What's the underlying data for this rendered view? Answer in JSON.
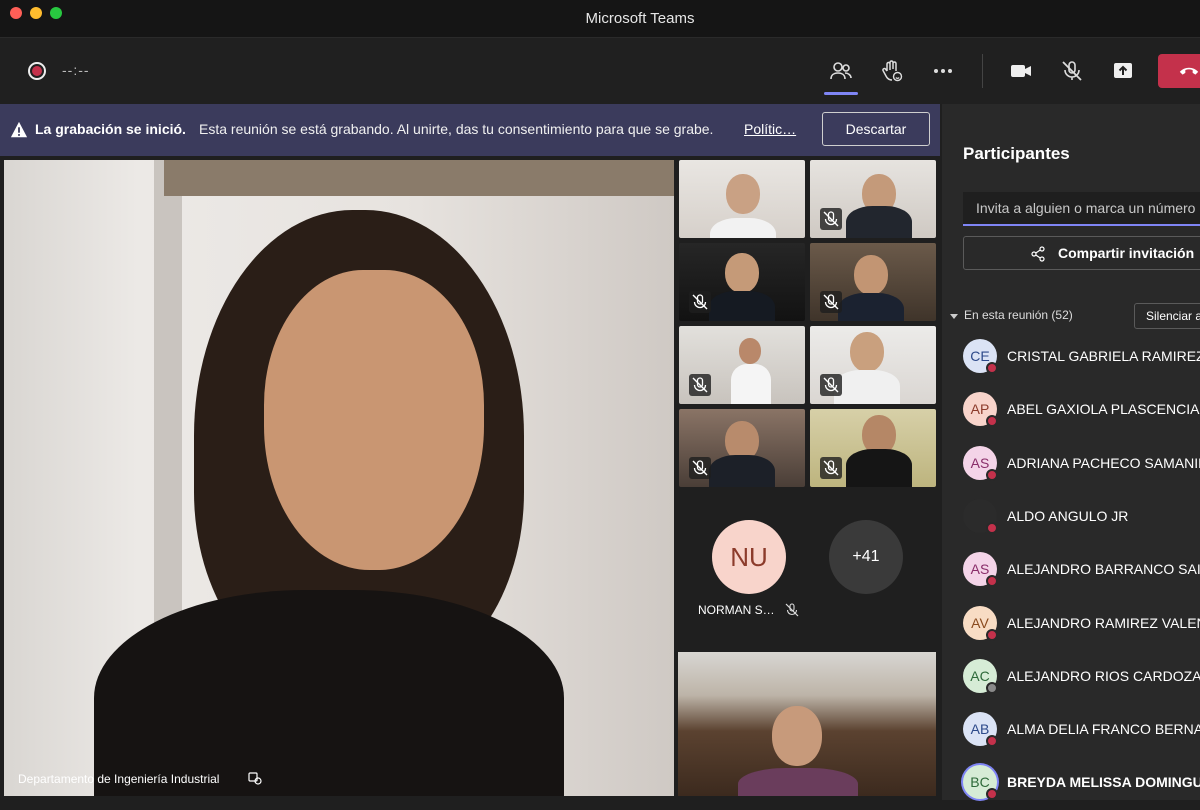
{
  "window": {
    "title": "Microsoft Teams"
  },
  "toolbar": {
    "recording_time": "--:--",
    "buttons": [
      {
        "icon": "people-icon"
      },
      {
        "icon": "raise-hand-icon"
      },
      {
        "icon": "more-options-icon"
      },
      {
        "icon": "camera-icon"
      },
      {
        "icon": "mic-off-icon"
      },
      {
        "icon": "share-screen-icon"
      },
      {
        "icon": "hang-up-icon"
      }
    ],
    "hangup_color": "#c4314b",
    "active_accent": "#7f85f5"
  },
  "banner": {
    "bold_text": "La grabación se inició.",
    "text": "Esta reunión se está grabando. Al unirte, das tu consentimiento para que se grabe.",
    "link": "Polític…",
    "dismiss_label": "Descartar"
  },
  "stage": {
    "main_name": "Departamento de Ingeniería Industrial",
    "avatar_initials": "NU",
    "avatar_name": "NORMAN S…",
    "more_count": "+41"
  },
  "panel": {
    "title": "Participantes",
    "invite_placeholder": "Invita a alguien o marca un número",
    "share_label": "Compartir invitación",
    "section_label": "En esta reunión (52)",
    "mute_all_label": "Silenciar a todos",
    "participants": [
      {
        "initials": "CE",
        "name": "CRISTAL GABRIELA RAMIREZ",
        "bg": "#dbe3f5",
        "fg": "#2e4a8a"
      },
      {
        "initials": "AP",
        "name": "ABEL GAXIOLA PLASCENCIA",
        "bg": "#f8d4cb",
        "fg": "#8c3b2b"
      },
      {
        "initials": "AS",
        "name": "ADRIANA PACHECO SAMANIEGO",
        "bg": "#f4d4e8",
        "fg": "#8a2e6a"
      },
      {
        "initials": "",
        "name": "ALDO ANGULO JR",
        "bg": "#2b2b2b",
        "fg": "#ffffff"
      },
      {
        "initials": "AS",
        "name": "ALEJANDRO BARRANCO SAINZ",
        "bg": "#f4d4e8",
        "fg": "#8a2e6a"
      },
      {
        "initials": "AV",
        "name": "ALEJANDRO RAMIREZ VALENZUELA",
        "bg": "#f8dcc4",
        "fg": "#8a4a1e"
      },
      {
        "initials": "AC",
        "name": "ALEJANDRO RIOS CARDOZA",
        "bg": "#d6ecd6",
        "fg": "#2e6a3a"
      },
      {
        "initials": "AB",
        "name": "ALMA DELIA FRANCO BERNAL",
        "bg": "#dbe3f5",
        "fg": "#2e4a8a"
      },
      {
        "initials": "BC",
        "name": "BREYDA MELISSA DOMINGUEZ",
        "bg": "#d6ecd6",
        "fg": "#2e6a3a"
      }
    ]
  }
}
